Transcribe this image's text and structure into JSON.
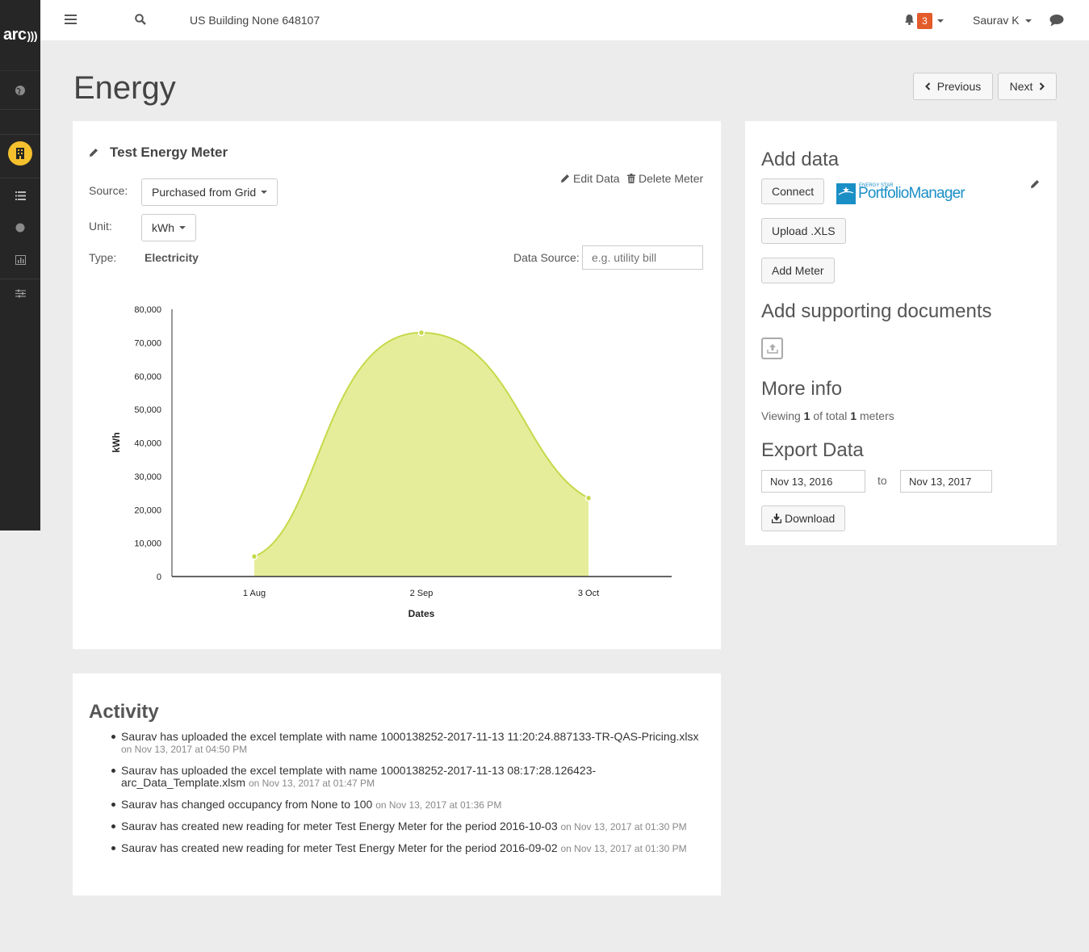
{
  "sidebar": {
    "logo": "arc",
    "items": [
      {
        "icon": "globe-icon",
        "active": false
      },
      {
        "icon": "building-icon",
        "active": true
      },
      {
        "icon": "list-icon",
        "active": false
      },
      {
        "icon": "circle-icon",
        "active": false
      },
      {
        "icon": "bar-chart-icon",
        "active": false
      },
      {
        "icon": "sliders-icon",
        "active": false
      }
    ]
  },
  "topbar": {
    "building_name": "US Building None 648107",
    "notification_count": "3",
    "user_name": "Saurav K"
  },
  "page": {
    "title": "Energy",
    "prev_label": "Previous",
    "next_label": "Next"
  },
  "meter": {
    "name": "Test Energy Meter",
    "edit_label": "Edit Data",
    "delete_label": "Delete Meter",
    "source_label": "Source:",
    "source_value": "Purchased from Grid",
    "unit_label": "Unit:",
    "unit_value": "kWh",
    "type_label": "Type:",
    "type_value": "Electricity",
    "data_source_label": "Data Source:",
    "data_source_placeholder": "e.g. utility bill"
  },
  "chart_data": {
    "type": "area",
    "x": [
      "1 Aug",
      "2 Sep",
      "3 Oct"
    ],
    "values": [
      6000,
      73000,
      23500
    ],
    "xlabel": "Dates",
    "ylabel": "kWh",
    "ylim": [
      0,
      80000
    ],
    "yticks": [
      "0",
      "10,000",
      "20,000",
      "30,000",
      "40,000",
      "50,000",
      "60,000",
      "70,000",
      "80,000"
    ],
    "fill_color": "#e6ed9a",
    "line_color": "#c5d94a",
    "grid": false
  },
  "add_data": {
    "title": "Add data",
    "connect_label": "Connect",
    "pm_small": "ENERGY STAR",
    "pm_name": "PortfolioManager",
    "upload_label": "Upload .XLS",
    "add_meter_label": "Add Meter",
    "supporting_title": "Add supporting documents",
    "more_info_title": "More info",
    "viewing_prefix": "Viewing",
    "viewing_count": "1",
    "viewing_mid": "of total",
    "viewing_total": "1",
    "viewing_suffix": "meters",
    "export_title": "Export Data",
    "date_from": "Nov 13, 2016",
    "date_to_label": "to",
    "date_to": "Nov 13, 2017",
    "download_label": "Download"
  },
  "activity": {
    "title": "Activity",
    "items": [
      {
        "text": "Saurav has uploaded the excel template with name 1000138252-2017-11-13 11:20:24.887133-TR-QAS-Pricing.xlsx",
        "time": "on Nov 13, 2017 at 04:50 PM"
      },
      {
        "text": "Saurav has uploaded the excel template with name 1000138252-2017-11-13 08:17:28.126423-arc_Data_Template.xlsm",
        "time": "on Nov 13, 2017 at 01:47 PM"
      },
      {
        "text": "Saurav has changed occupancy from None to 100",
        "time": "on Nov 13, 2017 at 01:36 PM"
      },
      {
        "text": "Saurav has created new reading for meter Test Energy Meter for the period 2016-10-03",
        "time": "on Nov 13, 2017 at 01:30 PM"
      },
      {
        "text": "Saurav has created new reading for meter Test Energy Meter for the period 2016-09-02",
        "time": "on Nov 13, 2017 at 01:30 PM"
      }
    ]
  }
}
